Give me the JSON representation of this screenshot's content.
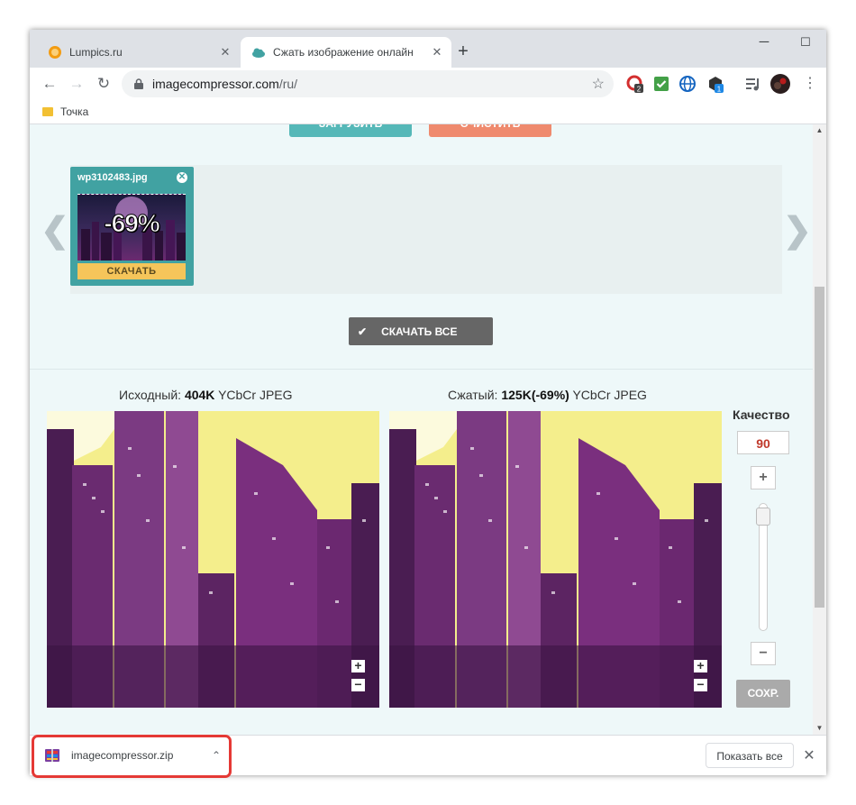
{
  "browser": {
    "tabs": [
      {
        "title": "Lumpics.ru",
        "close": "✕"
      },
      {
        "title": "Сжать изображение онлайн",
        "close": "✕"
      }
    ],
    "new_tab": "+",
    "window_controls": {
      "minimize": "─",
      "maximize": "☐",
      "close": "✕"
    },
    "nav": {
      "back": "←",
      "forward": "→",
      "reload": "↻"
    },
    "url_host": "imagecompressor.com",
    "url_path": "/ru/",
    "star": "☆",
    "extension_badges": {
      "ext1": "2",
      "ext4": "1"
    },
    "menu": "⋮",
    "bookmark": "Точка"
  },
  "page": {
    "upload_button": "ЗАГРУЗИТЬ",
    "clear_button": "ОЧИСТИТЬ",
    "file": {
      "name": "wp3102483.jpg",
      "close": "✕",
      "reduction": "-69%",
      "download": "СКАЧАТЬ"
    },
    "prev_arrow": "❮",
    "next_arrow": "❯",
    "download_all": "СКАЧАТЬ ВСЕ",
    "download_all_icon": "✔",
    "original": {
      "label": "Исходный:",
      "size": "404K",
      "format": "YCbCr JPEG"
    },
    "compressed": {
      "label": "Сжатый:",
      "size": "125K(-69%)",
      "format": "YCbCr JPEG"
    },
    "zoom_in": "+",
    "zoom_out": "−",
    "quality": {
      "label": "Качество",
      "value": "90",
      "plus": "+",
      "minus": "−",
      "save": "СОХР."
    }
  },
  "downloads": {
    "item": "imagecompressor.zip",
    "chevron": "⌃",
    "show_all": "Показать все",
    "close": "✕"
  },
  "colors": {
    "accent_teal": "#41a2a2",
    "clear_red": "#ef8a6e",
    "highlight": "#e53935",
    "quality_value": "#c0392b"
  }
}
